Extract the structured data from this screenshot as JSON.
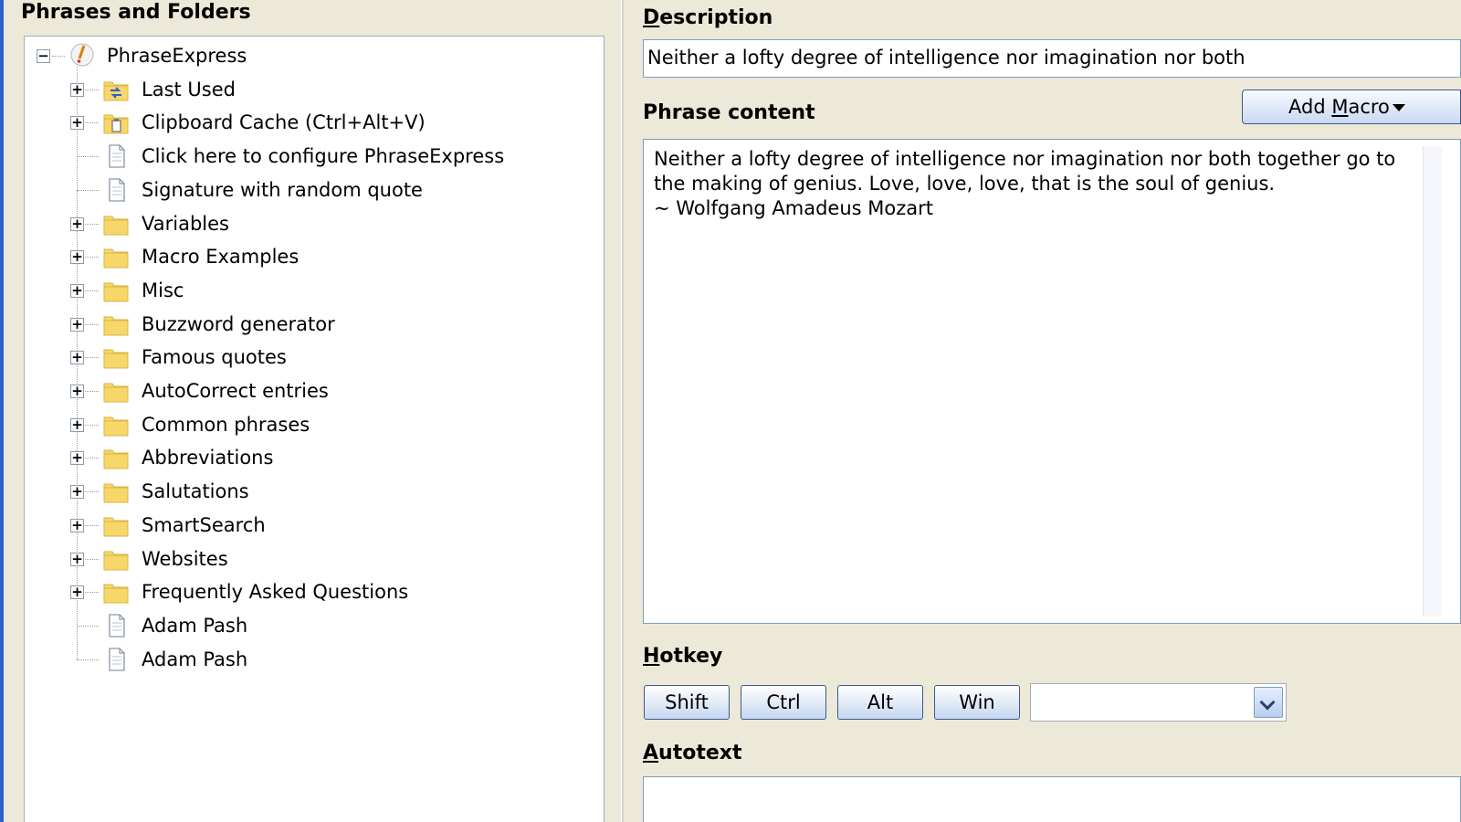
{
  "phrases_panel": {
    "title": "Phrases and Folders",
    "root": {
      "label": "PhraseExpress",
      "icon": "phraseexpress-logo-icon"
    },
    "items": [
      {
        "label": "Last Used",
        "icon": "last-used-folder-icon",
        "expandable": true
      },
      {
        "label": "Clipboard Cache (Ctrl+Alt+V)",
        "icon": "clipboard-folder-icon",
        "expandable": true
      },
      {
        "label": "Click here to configure PhraseExpress",
        "icon": "document-icon",
        "expandable": false
      },
      {
        "label": "Signature with random quote",
        "icon": "document-icon",
        "expandable": false
      },
      {
        "label": "Variables",
        "icon": "folder-icon",
        "expandable": true
      },
      {
        "label": "Macro Examples",
        "icon": "folder-icon",
        "expandable": true
      },
      {
        "label": "Misc",
        "icon": "folder-icon",
        "expandable": true
      },
      {
        "label": "Buzzword generator",
        "icon": "folder-icon",
        "expandable": true
      },
      {
        "label": "Famous quotes",
        "icon": "folder-icon",
        "expandable": true
      },
      {
        "label": "AutoCorrect entries",
        "icon": "folder-icon",
        "expandable": true
      },
      {
        "label": "Common phrases",
        "icon": "folder-icon",
        "expandable": true
      },
      {
        "label": "Abbreviations",
        "icon": "folder-icon",
        "expandable": true
      },
      {
        "label": "Salutations",
        "icon": "folder-icon",
        "expandable": true
      },
      {
        "label": "SmartSearch",
        "icon": "folder-icon",
        "expandable": true
      },
      {
        "label": "Websites",
        "icon": "folder-icon",
        "expandable": true
      },
      {
        "label": "Frequently Asked Questions",
        "icon": "folder-icon",
        "expandable": true
      },
      {
        "label": "Adam Pash",
        "icon": "document-icon",
        "expandable": false
      },
      {
        "label": "Adam Pash",
        "icon": "document-icon",
        "expandable": false
      }
    ]
  },
  "description": {
    "label_accel": "D",
    "label_rest": "escription",
    "value": "Neither a lofty degree of intelligence nor imagination nor both"
  },
  "phrase_content": {
    "label": "Phrase content",
    "text": "Neither a lofty degree of intelligence nor imagination nor both together go to the making of genius. Love, love, love, that is the soul of genius.\n~ Wolfgang Amadeus Mozart",
    "add_macro_before": "Add ",
    "add_macro_accel": "M",
    "add_macro_after": "acro"
  },
  "hotkey": {
    "label_accel": "H",
    "label_rest": "otkey",
    "modifiers": [
      "Shift",
      "Ctrl",
      "Alt",
      "Win"
    ],
    "key_value": ""
  },
  "autotext": {
    "label_accel": "A",
    "label_rest": "utotext",
    "value": ""
  },
  "colors": {
    "folder": "#f7d66a",
    "window_accent": "#2f5fc8",
    "panel_bg": "#ece9d8"
  }
}
